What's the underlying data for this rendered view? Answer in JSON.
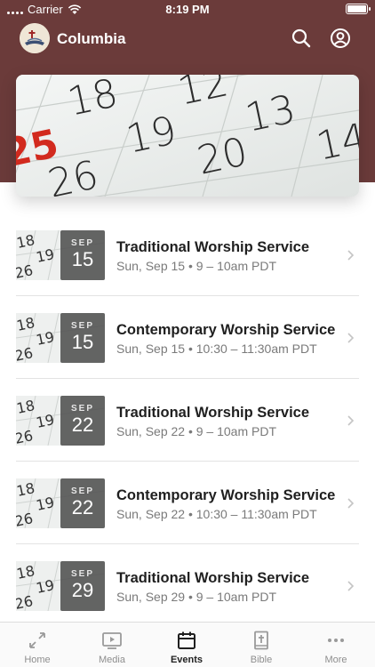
{
  "status_bar": {
    "carrier": "Carrier",
    "time": "8:19 PM"
  },
  "header": {
    "title": "Columbia",
    "background_color": "#6b3b3a"
  },
  "hero": {
    "numbers": [
      "18",
      "19",
      "20",
      "26",
      "12",
      "13",
      "14",
      "25"
    ]
  },
  "events": [
    {
      "month": "SEP",
      "day": "15",
      "title": "Traditional Worship Service",
      "time": "Sun, Sep 15 • 9 – 10am PDT"
    },
    {
      "month": "SEP",
      "day": "15",
      "title": "Contemporary Worship Service",
      "time": "Sun, Sep 15 • 10:30 – 11:30am PDT"
    },
    {
      "month": "SEP",
      "day": "22",
      "title": "Traditional Worship Service",
      "time": "Sun, Sep 22 • 9 – 10am PDT"
    },
    {
      "month": "SEP",
      "day": "22",
      "title": "Contemporary Worship Service",
      "time": "Sun, Sep 22 • 10:30 – 11:30am PDT"
    },
    {
      "month": "SEP",
      "day": "29",
      "title": "Traditional Worship Service",
      "time": "Sun, Sep 29 • 9 – 10am PDT"
    }
  ],
  "thumb_numbers": [
    "18",
    "19",
    "26"
  ],
  "tabs": [
    {
      "label": "Home",
      "icon": "home-icon"
    },
    {
      "label": "Media",
      "icon": "media-icon"
    },
    {
      "label": "Events",
      "icon": "events-icon",
      "active": true
    },
    {
      "label": "Bible",
      "icon": "bible-icon"
    },
    {
      "label": "More",
      "icon": "more-icon"
    }
  ]
}
